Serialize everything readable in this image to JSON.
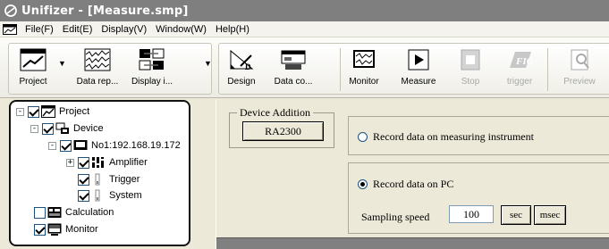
{
  "window": {
    "title": "Unifizer - [Measure.smp]"
  },
  "menubar": {
    "items": [
      "File(F)",
      "Edit(E)",
      "Display(V)",
      "Window(W)",
      "Help(H)"
    ]
  },
  "toolbar": {
    "project": "Project",
    "data_report": "Data rep...",
    "display": "Display i...",
    "design": "Design",
    "data_collection": "Data co...",
    "monitor": "Monitor",
    "measure": "Measure",
    "stop": "Stop",
    "trigger": "trigger",
    "preview": "Preview"
  },
  "tree": {
    "items": [
      {
        "label": "Project",
        "icon": "project-icon",
        "expander": "-",
        "checked": true
      },
      {
        "label": "Device",
        "icon": "device-icon",
        "expander": "-",
        "checked": true
      },
      {
        "label": "No1:192.168.19.172",
        "icon": "instrument-icon",
        "expander": "-",
        "checked": true
      },
      {
        "label": "Amplifier",
        "icon": "amplifier-icon",
        "expander": "+",
        "checked": true
      },
      {
        "label": "Trigger",
        "icon": "trigger-icon",
        "expander": "",
        "checked": true
      },
      {
        "label": "System",
        "icon": "system-icon",
        "expander": "",
        "checked": true
      },
      {
        "label": "Calculation",
        "icon": "calculation-icon",
        "expander": "",
        "checked": false
      },
      {
        "label": "Monitor",
        "icon": "monitor-icon",
        "expander": "",
        "checked": true
      }
    ]
  },
  "design": {
    "device_addition_legend": "Device Addition",
    "device_button": "RA2300",
    "record_instrument_label": "Record data on measuring instrument",
    "record_instrument_selected": false,
    "record_pc_label": "Record data on PC",
    "record_pc_selected": true,
    "sampling_label": "Sampling speed",
    "sampling_value": "100",
    "unit_sec": "sec",
    "unit_msec": "msec"
  },
  "colors": {
    "titlebar_bg": "#7f7f7f",
    "window_bg": "#ece9d8",
    "tree_border": "#111111"
  }
}
